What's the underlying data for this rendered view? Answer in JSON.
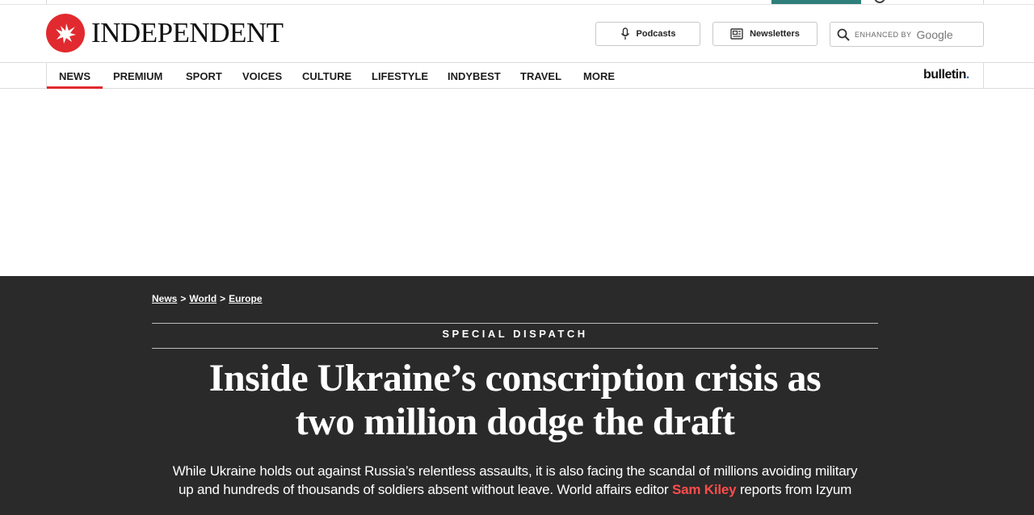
{
  "header": {
    "logo_text": "INDEPENDENT",
    "podcasts_label": "Podcasts",
    "newsletters_label": "Newsletters",
    "search": {
      "prefix": "ENHANCED BY",
      "brand": "Google"
    }
  },
  "nav": {
    "items": [
      {
        "label": "NEWS",
        "active": true
      },
      {
        "label": "PREMIUM"
      },
      {
        "label": "SPORT"
      },
      {
        "label": "VOICES"
      },
      {
        "label": "CULTURE"
      },
      {
        "label": "LIFESTYLE"
      },
      {
        "label": "INDYBEST"
      },
      {
        "label": "TRAVEL"
      },
      {
        "label": "MORE"
      }
    ],
    "bulletin_label": "bulletin",
    "bulletin_dot": "."
  },
  "article": {
    "breadcrumbs": [
      {
        "label": "News"
      },
      {
        "label": "World"
      },
      {
        "label": "Europe"
      }
    ],
    "breadcrumb_separator": ">",
    "kicker": "SPECIAL DISPATCH",
    "headline_line1": "Inside Ukraine’s conscription crisis as",
    "headline_line2": "two million dodge the draft",
    "standfirst_line1": "While Ukraine holds out against Russia’s relentless assaults, it is also facing the scandal of millions avoiding military",
    "standfirst_line2_pre": "up and hundreds of thousands of soldiers absent without leave. World affairs editor ",
    "author": "Sam Kiley",
    "standfirst_line2_post": " reports from Izyum"
  },
  "colors": {
    "brand_red": "#e12a2f",
    "dark_background": "#2a2a2a",
    "author_link": "#ff4c4c",
    "top_accent": "#2f7f7a"
  },
  "icons": [
    "eagle-logo-icon",
    "microphone-icon",
    "newsletter-icon",
    "search-icon"
  ]
}
